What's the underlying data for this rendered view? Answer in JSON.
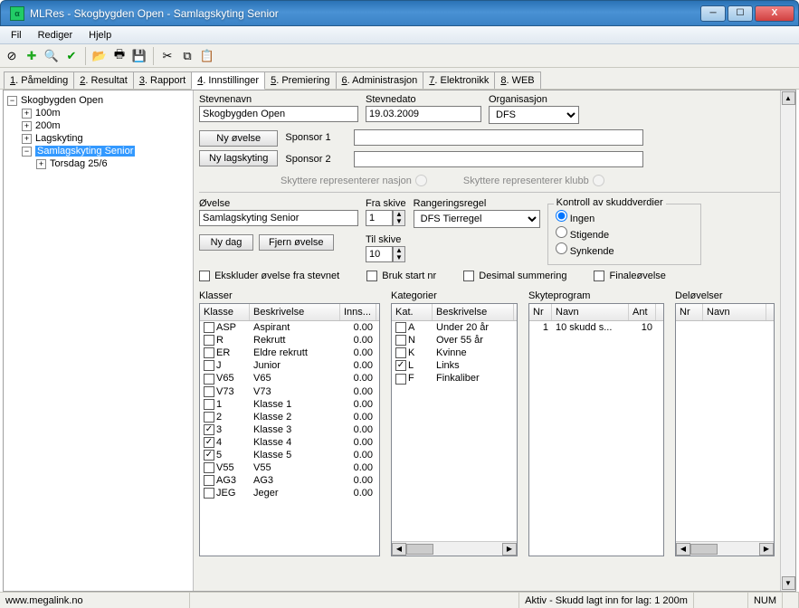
{
  "window": {
    "title": "MLRes - Skogbygden Open - Samlagskyting Senior"
  },
  "menu": {
    "fil": "Fil",
    "rediger": "Rediger",
    "hjelp": "Hjelp"
  },
  "tabs": [
    {
      "num": "1",
      "label": "Påmelding",
      "active": false
    },
    {
      "num": "2",
      "label": "Resultat",
      "active": false
    },
    {
      "num": "3",
      "label": "Rapport",
      "active": false
    },
    {
      "num": "4",
      "label": "Innstillinger",
      "active": true
    },
    {
      "num": "5",
      "label": "Premiering",
      "active": false
    },
    {
      "num": "6",
      "label": "Administrasjon",
      "active": false
    },
    {
      "num": "7",
      "label": "Elektronikk",
      "active": false
    },
    {
      "num": "8",
      "label": "WEB",
      "active": false
    }
  ],
  "tree": {
    "root": "Skogbygden Open",
    "items": [
      "100m",
      "200m",
      "Lagskyting"
    ],
    "sel": "Samlagskyting Senior",
    "child": "Torsdag 25/6"
  },
  "top": {
    "stevnenavn_label": "Stevnenavn",
    "stevnenavn": "Skogbygden Open",
    "stevnedato_label": "Stevnedato",
    "stevnedato": "19.03.2009",
    "org_label": "Organisasjon",
    "org": "DFS",
    "ny_ovelse": "Ny øvelse",
    "ny_lagskyting": "Ny lagskyting",
    "sponsor1": "Sponsor 1",
    "sponsor2": "Sponsor 2",
    "rep_nasjon": "Skyttere representerer nasjon",
    "rep_klubb": "Skyttere representerer klubb"
  },
  "mid": {
    "ovelse_label": "Øvelse",
    "ovelse": "Samlagskyting Senior",
    "ny_dag": "Ny dag",
    "fjern_ovelse": "Fjern øvelse",
    "fra_skive_label": "Fra skive",
    "fra_skive": "1",
    "til_skive_label": "Til skive",
    "til_skive": "10",
    "rangering_label": "Rangeringsregel",
    "rangering": "DFS Tierregel",
    "kontroll_label": "Kontroll av skuddverdier",
    "radio_ingen": "Ingen",
    "radio_stigende": "Stigende",
    "radio_synkende": "Synkende",
    "chk_ekskluder": "Ekskluder øvelse fra stevnet",
    "chk_brukstart": "Bruk start nr",
    "chk_desimal": "Desimal summering",
    "chk_finale": "Finaleøvelse"
  },
  "klasser": {
    "title": "Klasser",
    "cols": [
      "Klasse",
      "Beskrivelse",
      "Inns..."
    ],
    "rows": [
      {
        "c": false,
        "k": "ASP",
        "b": "Aspirant",
        "i": "0.00"
      },
      {
        "c": false,
        "k": "R",
        "b": "Rekrutt",
        "i": "0.00"
      },
      {
        "c": false,
        "k": "ER",
        "b": "Eldre rekrutt",
        "i": "0.00"
      },
      {
        "c": false,
        "k": "J",
        "b": "Junior",
        "i": "0.00"
      },
      {
        "c": false,
        "k": "V65",
        "b": "V65",
        "i": "0.00"
      },
      {
        "c": false,
        "k": "V73",
        "b": "V73",
        "i": "0.00"
      },
      {
        "c": false,
        "k": "1",
        "b": "Klasse 1",
        "i": "0.00"
      },
      {
        "c": false,
        "k": "2",
        "b": "Klasse 2",
        "i": "0.00"
      },
      {
        "c": true,
        "k": "3",
        "b": "Klasse 3",
        "i": "0.00"
      },
      {
        "c": true,
        "k": "4",
        "b": "Klasse 4",
        "i": "0.00"
      },
      {
        "c": true,
        "k": "5",
        "b": "Klasse 5",
        "i": "0.00"
      },
      {
        "c": false,
        "k": "V55",
        "b": "V55",
        "i": "0.00"
      },
      {
        "c": false,
        "k": "AG3",
        "b": "AG3",
        "i": "0.00"
      },
      {
        "c": false,
        "k": "JEG",
        "b": "Jeger",
        "i": "0.00"
      }
    ]
  },
  "kategorier": {
    "title": "Kategorier",
    "cols": [
      "Kat.",
      "Beskrivelse"
    ],
    "rows": [
      {
        "c": false,
        "k": "A",
        "b": "Under 20 år"
      },
      {
        "c": false,
        "k": "N",
        "b": "Over 55 år"
      },
      {
        "c": false,
        "k": "K",
        "b": "Kvinne"
      },
      {
        "c": true,
        "k": "L",
        "b": "Links"
      },
      {
        "c": false,
        "k": "F",
        "b": "Finkaliber"
      }
    ]
  },
  "skyteprogram": {
    "title": "Skyteprogram",
    "cols": [
      "Nr",
      "Navn",
      "Ant"
    ],
    "rows": [
      {
        "n": "1",
        "navn": "10 skudd s...",
        "ant": "10"
      }
    ]
  },
  "delovelser": {
    "title": "Deløvelser",
    "cols": [
      "Nr",
      "Navn"
    ],
    "rows": []
  },
  "status": {
    "url": "www.megalink.no",
    "msg": "Aktiv - Skudd lagt inn for lag: 1 200m",
    "num": "NUM"
  }
}
